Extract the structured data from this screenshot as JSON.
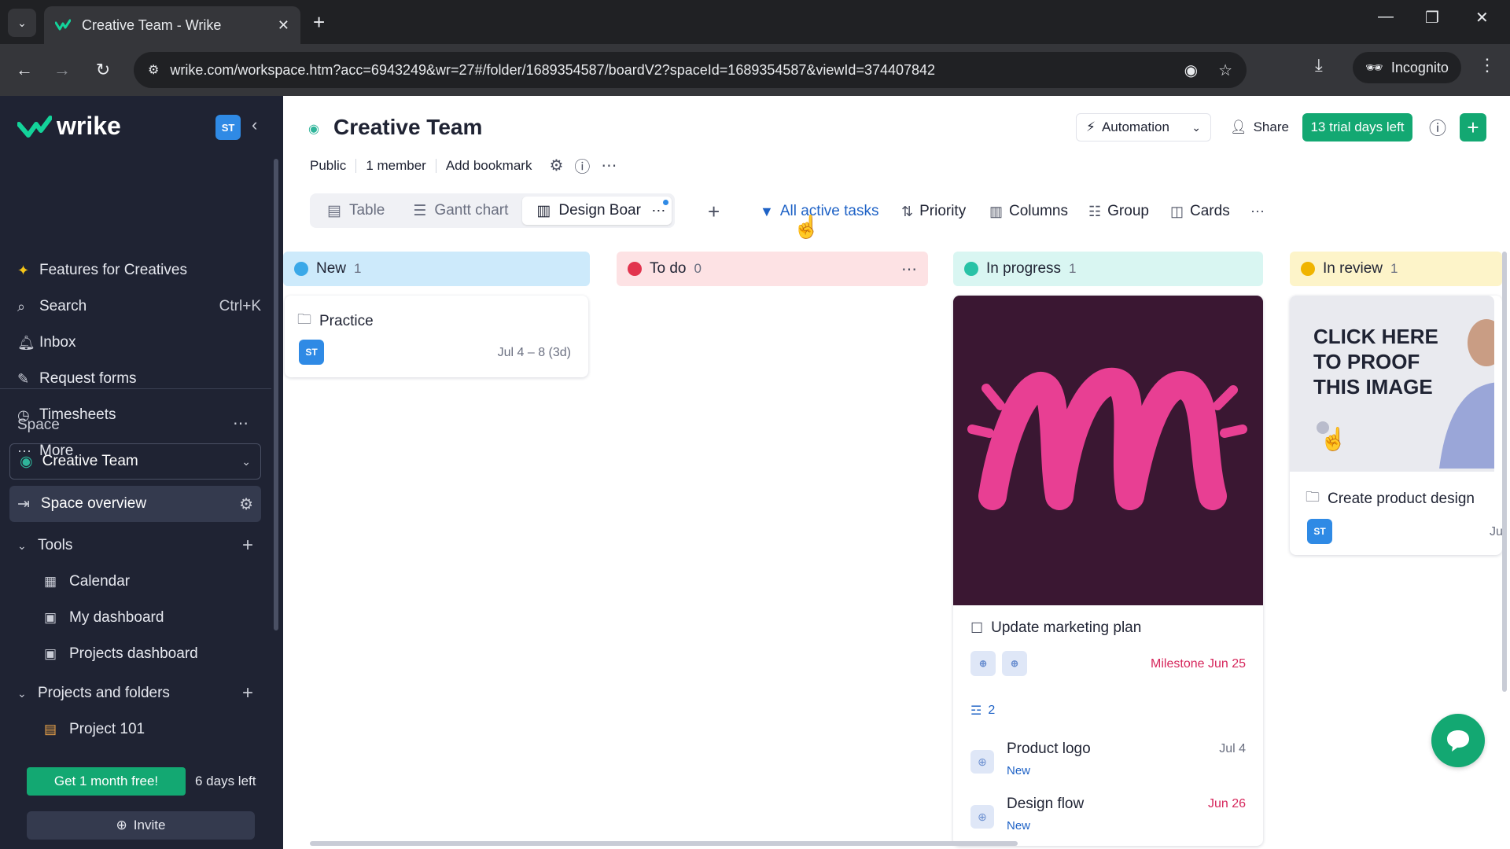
{
  "browser": {
    "tab_title": "Creative Team - Wrike",
    "url": "wrike.com/workspace.htm?acc=6943249&wr=27#/folder/1689354587/boardV2?spaceId=1689354587&viewId=374407842",
    "incognito_label": "Incognito"
  },
  "sidebar": {
    "logo": "wrike",
    "user_initials": "ST",
    "nav": [
      {
        "label": "Features for Creatives",
        "icon": "sparkle-icon"
      },
      {
        "label": "Search",
        "icon": "search-icon",
        "shortcut": "Ctrl+K"
      },
      {
        "label": "Inbox",
        "icon": "bell-icon"
      },
      {
        "label": "Request forms",
        "icon": "form-icon"
      },
      {
        "label": "Timesheets",
        "icon": "clock-icon"
      },
      {
        "label": "More",
        "icon": "dots-icon"
      }
    ],
    "space_label": "Space",
    "space_selected": "Creative Team",
    "space_overview": "Space overview",
    "tools_label": "Tools",
    "tools": [
      "Calendar",
      "My dashboard",
      "Projects dashboard"
    ],
    "projects_label": "Projects and folders",
    "projects": [
      "Project 101"
    ],
    "promo_button": "Get 1 month free!",
    "days_left": "6 days left",
    "invite": "Invite"
  },
  "header": {
    "title": "Creative Team",
    "visibility": "Public",
    "members": "1 member",
    "bookmark": "Add bookmark",
    "automation": "Automation",
    "share": "Share",
    "trial": "13 trial days left"
  },
  "views": {
    "tabs": [
      "Table",
      "Gantt chart",
      "Design Boar"
    ]
  },
  "toolbar": {
    "filter": "All active tasks",
    "priority": "Priority",
    "columns": "Columns",
    "group": "Group",
    "cards": "Cards"
  },
  "board": {
    "columns": [
      {
        "name": "New",
        "count": "1",
        "color": "#cdeafb",
        "dot": "#3aa8e8"
      },
      {
        "name": "To do",
        "count": "0",
        "color": "#fde2e4",
        "dot": "#e2344e"
      },
      {
        "name": "In progress",
        "count": "1",
        "color": "#d9f6f2",
        "dot": "#28c2a6"
      },
      {
        "name": "In review",
        "count": "1",
        "color": "#fdf4c9",
        "dot": "#f0b400"
      }
    ],
    "cards": {
      "practice": {
        "title": "Practice",
        "assignee": "ST",
        "date": "Jul 4 – 8 (3d)"
      },
      "marketing": {
        "title": "Update marketing plan",
        "milestone": "Milestone Jun 25",
        "subtask_count": "2",
        "subtasks": [
          {
            "name": "Product logo",
            "status": "New",
            "date": "Jul 4"
          },
          {
            "name": "Design flow",
            "status": "New",
            "date": "Jun 26"
          }
        ]
      },
      "product": {
        "title": "Create product design",
        "assignee": "ST",
        "date": "Ju",
        "image_text": "CLICK HERE TO PROOF THIS IMAGE"
      }
    }
  },
  "colors": {
    "brand_green": "#13a872",
    "sidebar_bg": "#1f2333",
    "link_blue": "#1e62c6",
    "milestone_red": "#d6275c"
  }
}
